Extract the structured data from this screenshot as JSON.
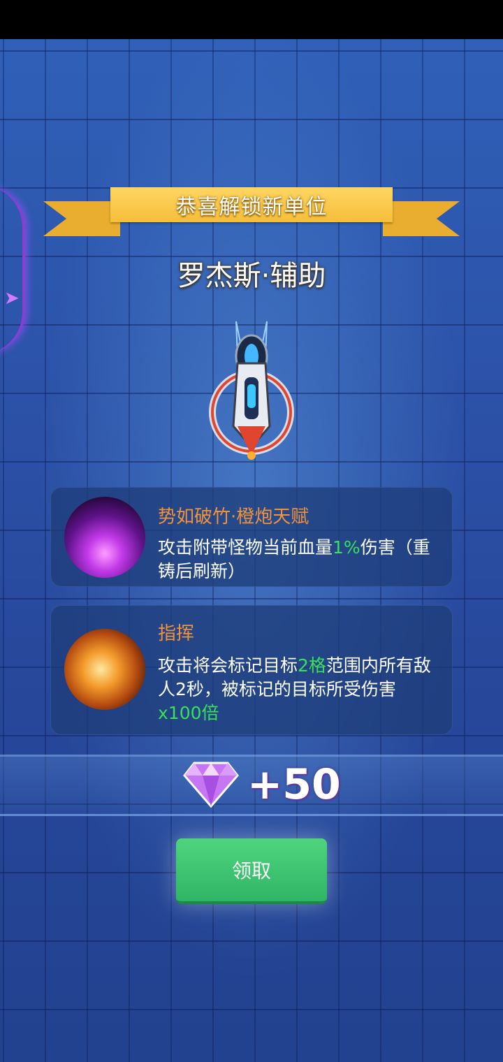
{
  "banner": {
    "title": "恭喜解锁新单位"
  },
  "unit": {
    "name": "罗杰斯·辅助",
    "icon": "spaceship-icon"
  },
  "skills": [
    {
      "title": "势如破竹·橙炮天赋",
      "icon": "purple-beam-icon",
      "desc_parts": [
        "攻击附带怪物当前血量",
        "1%",
        "伤害（重铸后刷新）"
      ]
    },
    {
      "title": "指挥",
      "icon": "fire-orb-icon",
      "desc_parts": [
        "攻击将会标记目标",
        "2格",
        "范围内所有敌人2秒，被标记的目标所受伤害",
        "x100倍"
      ]
    }
  ],
  "reward": {
    "icon": "diamond-icon",
    "amount": "+50"
  },
  "actions": {
    "claim_label": "领取"
  },
  "colors": {
    "ribbon": "#f5be3a",
    "highlight": "#39e05a",
    "skill_title": "#f2923a",
    "button": "#2fb565"
  }
}
